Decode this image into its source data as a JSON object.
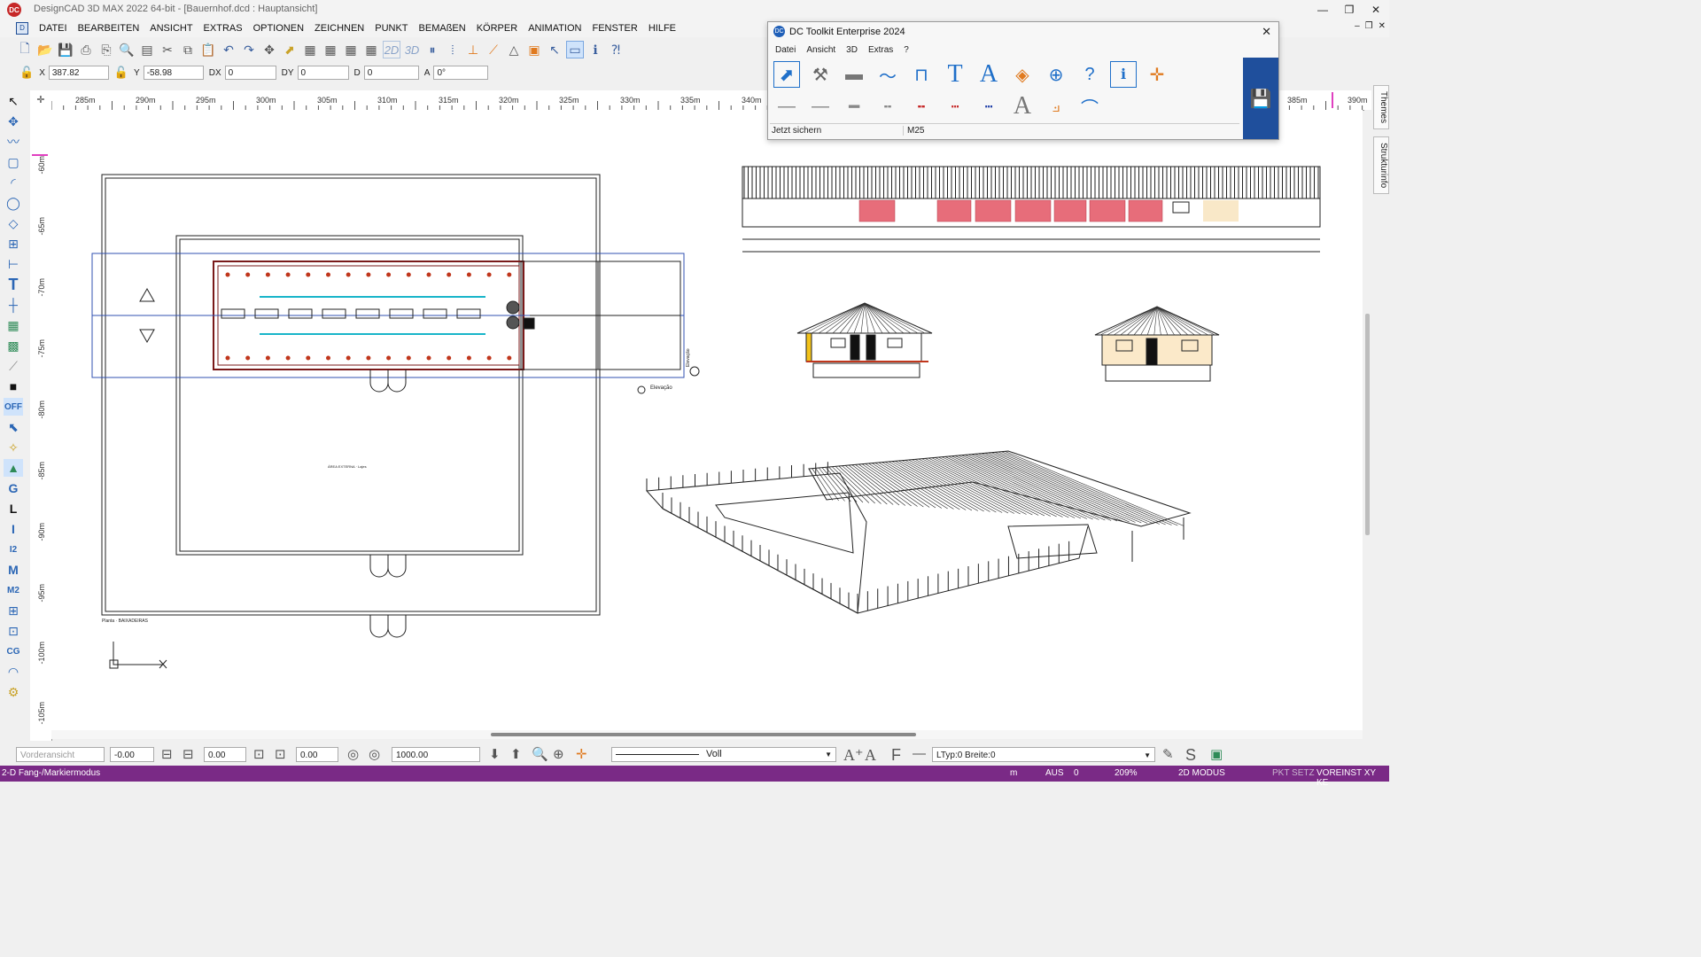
{
  "window": {
    "title": "DesignCAD 3D MAX 2022 64-bit - [Bauernhof.dcd : Hauptansicht]",
    "app_icon": "DC",
    "controls": [
      "—",
      "❐",
      "✕"
    ],
    "mdi_controls": [
      "–",
      "❐",
      "✕"
    ]
  },
  "menu": [
    "DATEI",
    "BEARBEITEN",
    "ANSICHT",
    "EXTRAS",
    "OPTIONEN",
    "ZEICHNEN",
    "PUNKT",
    "BEMAßEN",
    "KÖRPER",
    "ANIMATION",
    "FENSTER",
    "HILFE"
  ],
  "toolbar": {
    "view_2d": "2D",
    "view_3d": "3D"
  },
  "coords": {
    "x_label": "X",
    "x_value": "387.82",
    "y_label": "Y",
    "y_value": "-58.98",
    "dx_label": "DX",
    "dx_value": "0",
    "dy_label": "DY",
    "dy_value": "0",
    "d_label": "D",
    "d_value": "0",
    "a_label": "A",
    "a_value": "0°"
  },
  "ruler_top": [
    "285m",
    "290m",
    "295m",
    "300m",
    "305m",
    "310m",
    "315m",
    "320m",
    "325m",
    "330m",
    "335m",
    "340m",
    "385m",
    "390m"
  ],
  "ruler_left": [
    "-60m",
    "-65m",
    "-70m",
    "-75m",
    "-80m",
    "-85m",
    "-90m",
    "-95m",
    "-100m",
    "-105m"
  ],
  "left_tools": {
    "off_label": "OFF",
    "g_label": "G",
    "l_label": "L",
    "i_label": "I",
    "i2_label": "I2",
    "m_label": "M",
    "m2_label": "M2",
    "cg_label": "CG"
  },
  "side_tabs": [
    "Themes",
    "Strukturinfo"
  ],
  "palette": {
    "title": "DC Toolkit Enterprise 2024",
    "menu": [
      "Datei",
      "Ansicht",
      "3D",
      "Extras",
      "?"
    ],
    "status_left": "Jetzt sichern",
    "status_right": "M25",
    "text_icon_T": "T",
    "text_icon_A": "A",
    "text_icon_A2": "A",
    "question_icon": "?"
  },
  "drawing_labels": {
    "plan_label": "Planta · BAIXADEIRAS",
    "area_label": "ÁREA EXTERNA · Lajes",
    "elevation_1": "Elevação",
    "elevation_2": "Elevação"
  },
  "bottom_bar": {
    "view_select": "Vorderansicht",
    "field1": "-0.00",
    "field2": "0.00",
    "field3": "0.00",
    "field4": "1000.00",
    "line_style": "Voll",
    "ltype": "LTyp:0  Breite:0"
  },
  "status": {
    "mode": "2-D Fang-/Markiermodus",
    "unit": "m",
    "aus": "AUS",
    "zero": "0",
    "zoom": "209%",
    "dmode": "2D MODUS",
    "pkt": "PKT SETZ",
    "voreinst": "VOREINST XY KE"
  }
}
